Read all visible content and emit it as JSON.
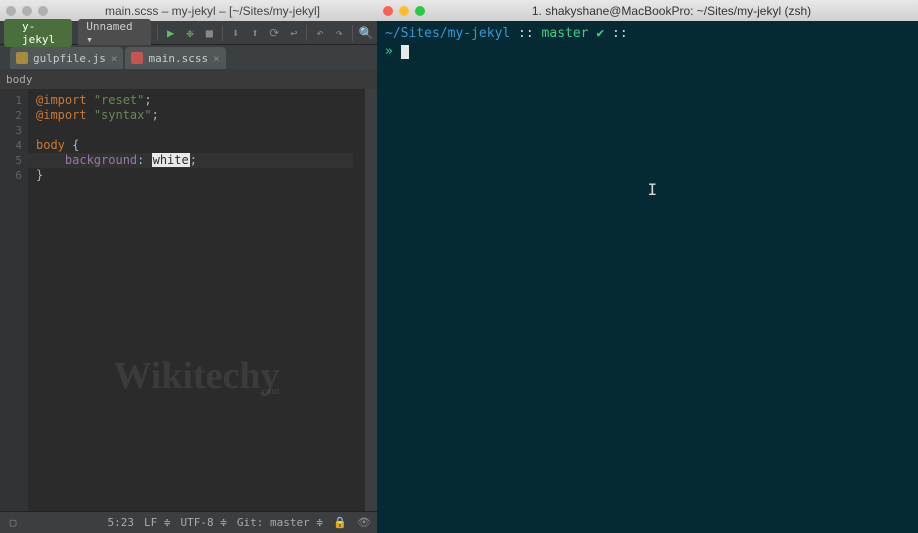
{
  "ide": {
    "title": "main.scss – my-jekyl – [~/Sites/my-jekyl]",
    "project_crumb": "y-jekyl",
    "run_config": "Unnamed ▾",
    "tabs": [
      {
        "label": "gulpfile.js"
      },
      {
        "label": "main.scss"
      }
    ],
    "breadcrumb": "body",
    "gutter": [
      "1",
      "2",
      "3",
      "4",
      "5",
      "6"
    ],
    "code": {
      "l1_kw": "@import",
      "l1_str": "\"reset\"",
      "l1_semi": ";",
      "l2_kw": "@import",
      "l2_str": "\"syntax\"",
      "l2_semi": ";",
      "l4_sel": "body",
      "l4_brace": " {",
      "l5_prop": "background",
      "l5_colon": ": ",
      "l5_val": "white",
      "l5_semi": ";",
      "l6_brace": "}"
    },
    "watermark": "Wikitechy",
    "watermark_sub": ".com",
    "status": {
      "pos": "5:23",
      "sep": "LF",
      "enc": "UTF-8",
      "git": "Git: master"
    }
  },
  "terminal": {
    "title": "1. shakyshane@MacBookPro: ~/Sites/my-jekyl (zsh)",
    "line1_path": "~/Sites/my-jekyl",
    "line1_sep1": " :: ",
    "line1_branch": "master",
    "line1_check": " ✔",
    "line1_sep2": " ::",
    "line2_prompt": "» "
  }
}
